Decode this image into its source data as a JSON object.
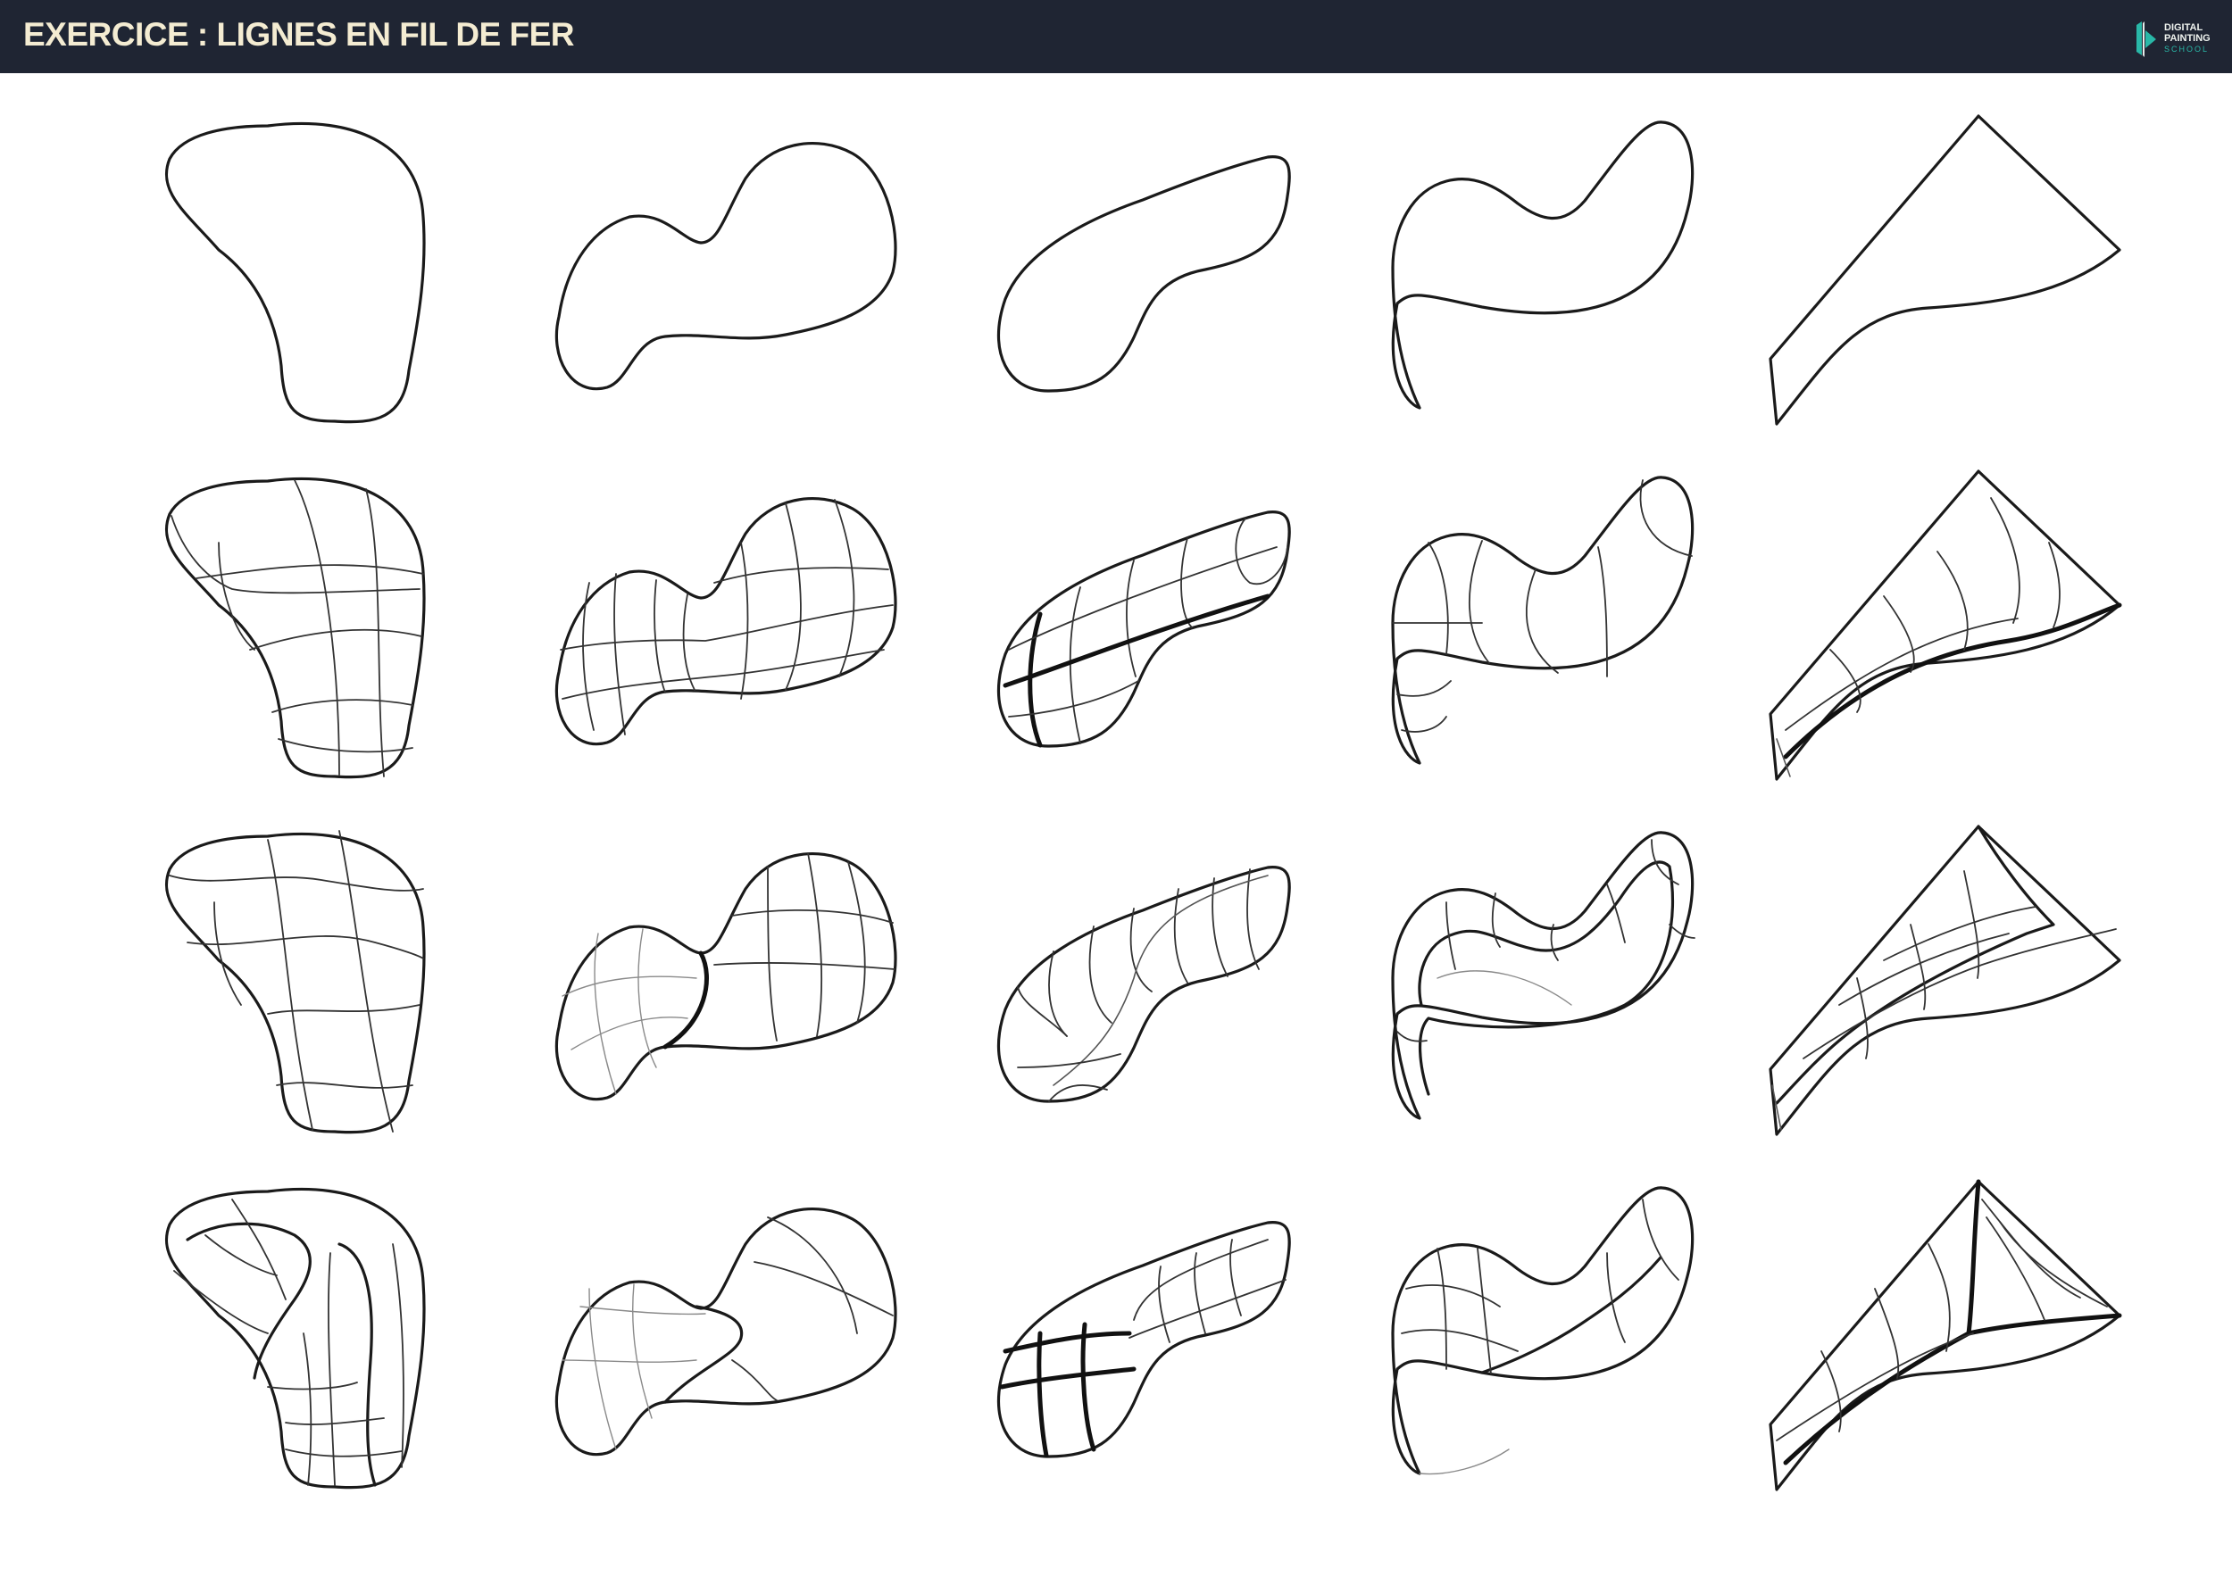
{
  "header": {
    "title": "EXERCICE : LIGNES EN FIL DE FER",
    "logo": {
      "line1": "DIGITAL",
      "line2": "PAINTING",
      "line3": "SCHOOL",
      "colors": {
        "background": "#1f2533",
        "title": "#f4ecd2",
        "accent": "#29b8a8"
      }
    }
  },
  "grid": {
    "columns": 5,
    "rows": 4,
    "shapes": [
      "blob",
      "bean",
      "capsule",
      "s-curve",
      "triangle-sheet"
    ],
    "row_styles": [
      "outline",
      "wireframe",
      "wireframe",
      "wireframe"
    ]
  }
}
